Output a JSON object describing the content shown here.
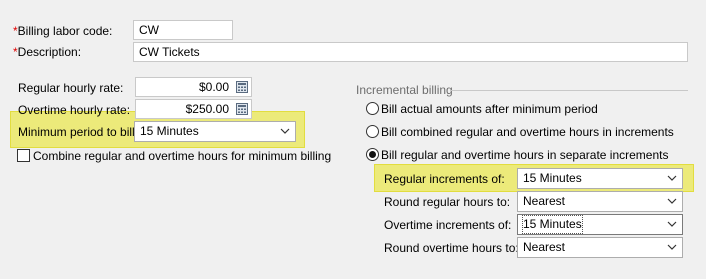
{
  "billing_labor_code": {
    "label": "Billing labor code:",
    "value": "CW"
  },
  "description": {
    "label": "Description:",
    "value": "CW Tickets"
  },
  "required_marker": "*",
  "regular_hourly_rate": {
    "label": "Regular hourly rate:",
    "value": "$0.00"
  },
  "overtime_hourly_rate": {
    "label": "Overtime hourly rate:",
    "value": "$250.00"
  },
  "minimum_period": {
    "label": "Minimum period to bill:",
    "value": "15  Minutes"
  },
  "combine_hours": {
    "label": "Combine regular and overtime hours for minimum billing",
    "checked": false
  },
  "incremental_billing": {
    "title": "Incremental billing",
    "options": [
      {
        "label": "Bill actual amounts after minimum period",
        "selected": false
      },
      {
        "label": "Bill combined regular and overtime hours in increments",
        "selected": false
      },
      {
        "label": "Bill regular and overtime hours in separate increments",
        "selected": true
      }
    ],
    "regular_increments": {
      "label": "Regular increments of:",
      "value": "15  Minutes"
    },
    "round_regular": {
      "label": "Round regular hours to:",
      "value": "Nearest"
    },
    "overtime_increments": {
      "label": "Overtime increments of:",
      "value": "15  Minutes"
    },
    "round_overtime": {
      "label": "Round overtime hours to:",
      "value": "Nearest"
    }
  },
  "colors": {
    "highlight": "#ecea7a",
    "required": "#e00000"
  },
  "icons": {
    "calculator": "calculator-icon",
    "dropdown": "chevron-down-icon"
  }
}
